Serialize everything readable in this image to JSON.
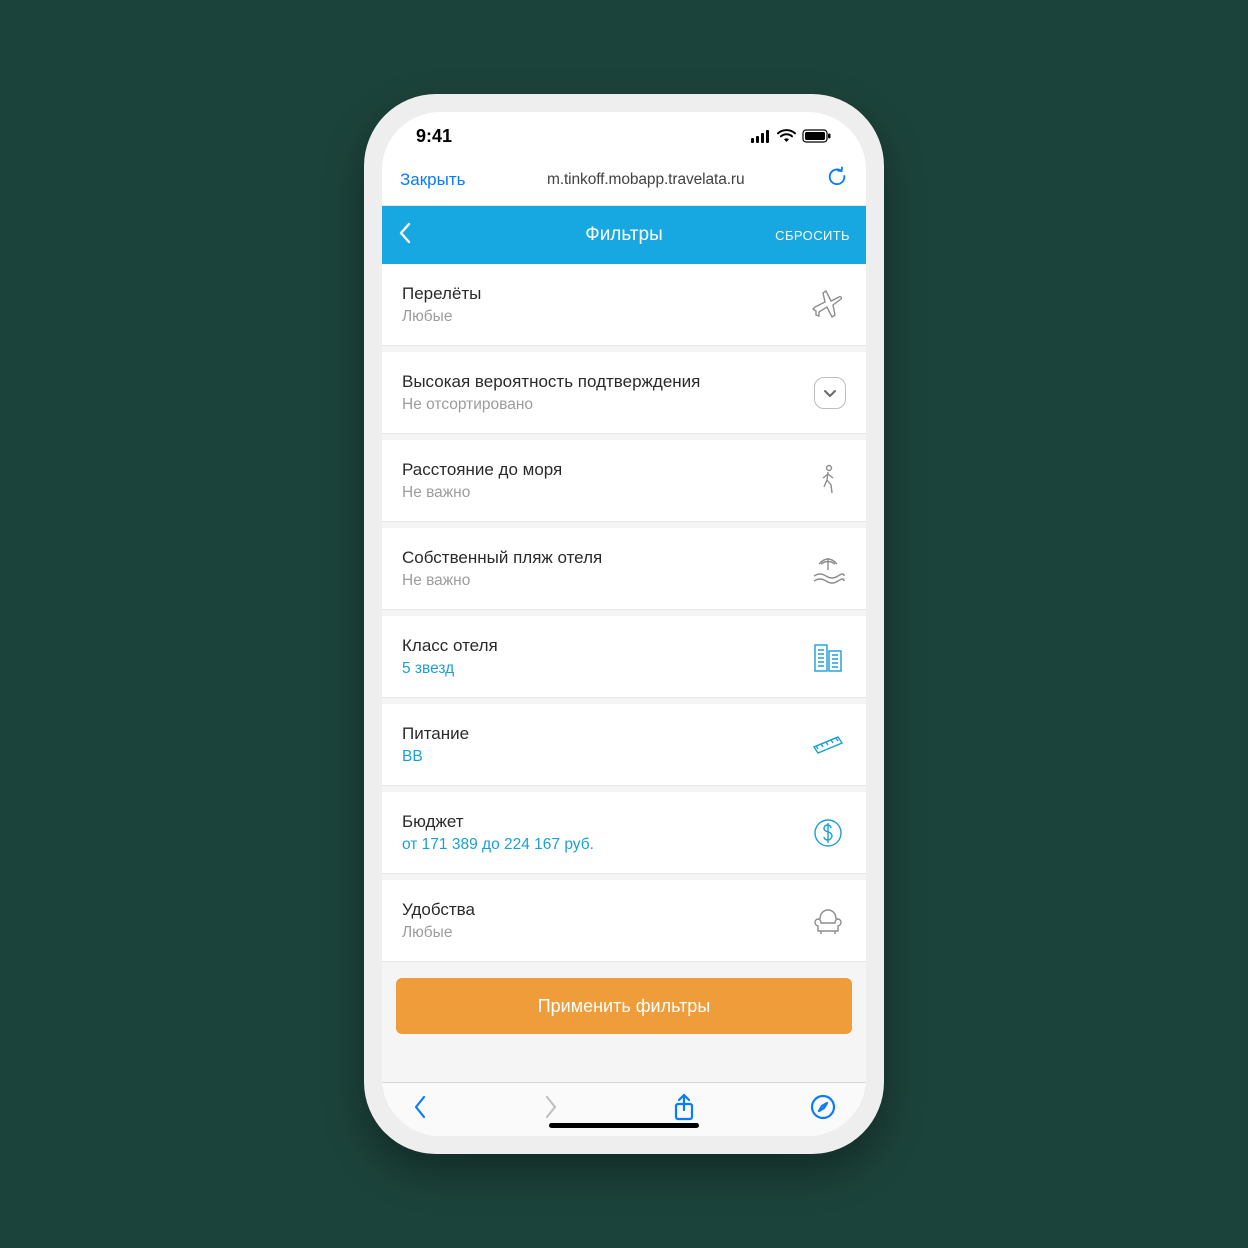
{
  "status": {
    "time": "9:41"
  },
  "browser": {
    "close_label": "Закрыть",
    "url": "m.tinkoff.mobapp.travelata.ru"
  },
  "header": {
    "title": "Фильтры",
    "reset_label": "СБРОСИТЬ"
  },
  "filters": {
    "flights": {
      "label": "Перелёты",
      "value": "Любые",
      "active": false,
      "icon": "plane"
    },
    "confirm": {
      "label": "Высокая вероятность подтверждения",
      "value": "Не отсортировано",
      "active": false,
      "icon": "checkbox"
    },
    "sea": {
      "label": "Расстояние до моря",
      "value": "Не важно",
      "active": false,
      "icon": "walk"
    },
    "beach": {
      "label": "Собственный пляж отеля",
      "value": "Не важно",
      "active": false,
      "icon": "beach"
    },
    "class": {
      "label": "Класс отеля",
      "value": "5 звезд",
      "active": true,
      "icon": "buildings"
    },
    "meal": {
      "label": "Питание",
      "value": "BB",
      "active": true,
      "icon": "sandwich"
    },
    "budget": {
      "label": "Бюджет",
      "value": "от 171 389 до 224 167 руб.",
      "active": true,
      "icon": "dollar"
    },
    "amenities": {
      "label": "Удобства",
      "value": "Любые",
      "active": false,
      "icon": "armchair"
    }
  },
  "apply_label": "Применить фильтры"
}
